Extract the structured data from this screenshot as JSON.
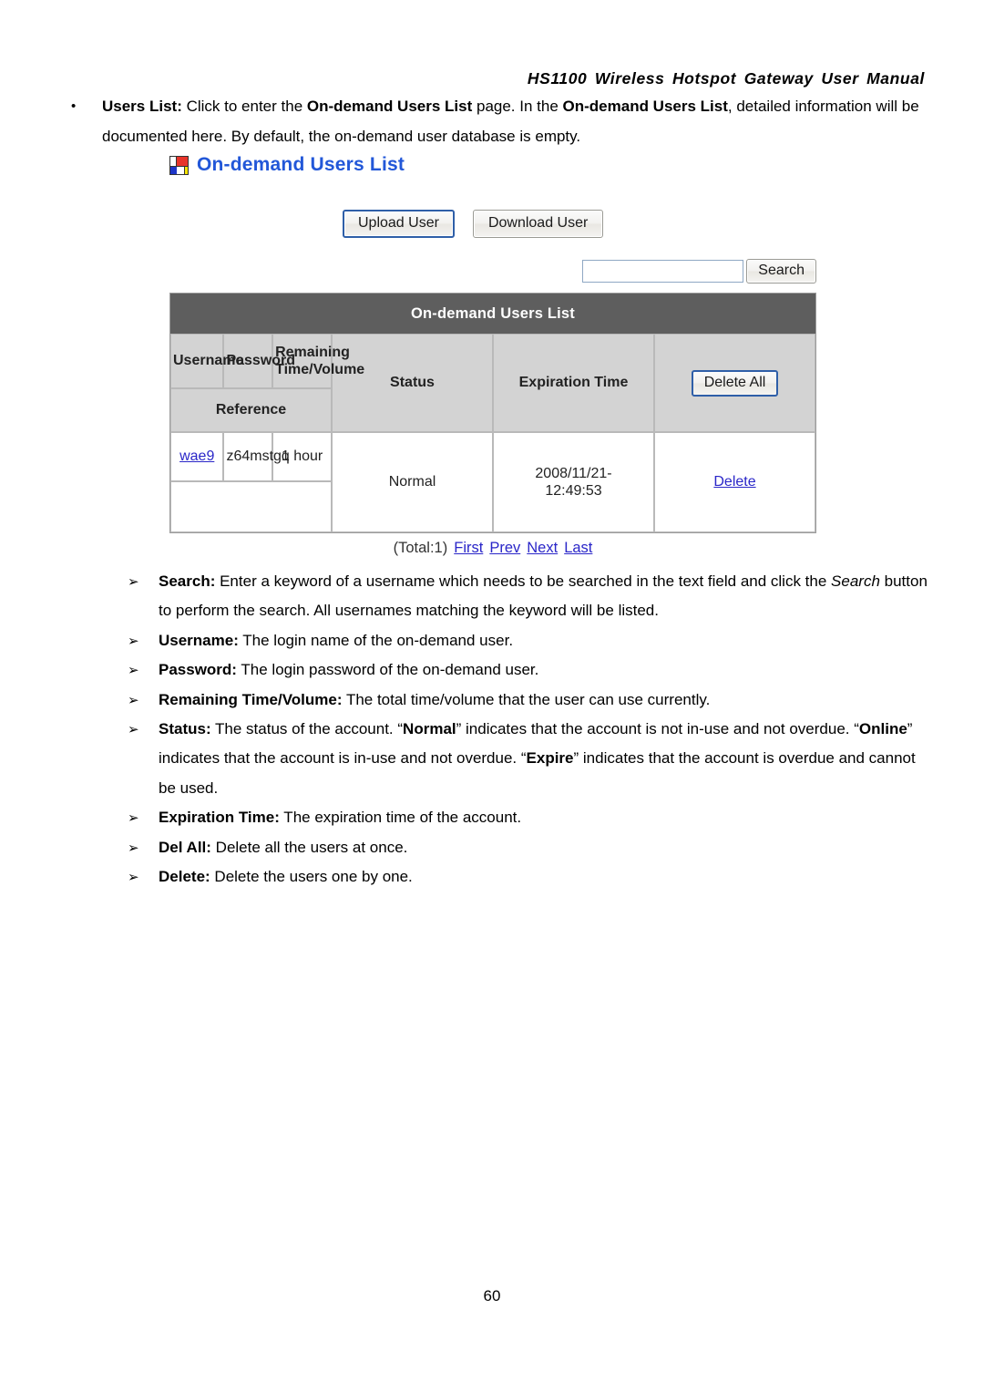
{
  "document": {
    "running_header": "HS1100 Wireless Hotspot Gateway User Manual",
    "page_number": "60"
  },
  "intro_bullet": {
    "marker": "•",
    "segments": [
      {
        "text": "Users List:",
        "style": "bold"
      },
      {
        "text": " Click to enter the ",
        "style": "normal"
      },
      {
        "text": "On-demand Users List",
        "style": "bold"
      },
      {
        "text": " page. In the ",
        "style": "normal"
      },
      {
        "text": "On-demand Users List",
        "style": "bold"
      },
      {
        "text": ", detailed information will be documented here. By default, the on-demand user database is empty.",
        "style": "normal"
      }
    ]
  },
  "screenshot": {
    "icon_name": "mondrian-squares-icon",
    "title": "On-demand Users List",
    "buttons": {
      "upload_user": "Upload User",
      "download_user": "Download User",
      "focused_button": "Upload User"
    },
    "search": {
      "value": "",
      "placeholder": "",
      "button_label": "Search"
    },
    "table": {
      "caption": "On-demand Users List",
      "headers": {
        "username": "Username",
        "password": "Password",
        "remaining_line1": "Remaining",
        "remaining_line2": "Time/Volume",
        "reference": "Reference",
        "status": "Status",
        "expiration_time": "Expiration Time",
        "delete_all": "Delete All"
      },
      "rows": [
        {
          "username": "wae9",
          "password": "z64mstgq",
          "remaining": "1 hour",
          "reference": "",
          "status": "Normal",
          "expiration_line1": "2008/11/21-",
          "expiration_line2": "12:49:53",
          "delete": "Delete"
        }
      ],
      "pager": {
        "total": "(Total:1)",
        "first": "First",
        "prev": "Prev",
        "next": "Next",
        "last": "Last"
      }
    },
    "colors": {
      "title_blue": "#2257d8",
      "caption_bar": "#5e5e5e",
      "header_gray": "#d3d3d3",
      "link_blue": "#2a26c8",
      "focus_border": "#2f5fa8"
    }
  },
  "definitions": [
    {
      "marker": "➢",
      "segments": [
        {
          "text": "Search:",
          "style": "bold"
        },
        {
          "text": " Enter a keyword of a username which needs to be searched in the text field and click the ",
          "style": "normal"
        },
        {
          "text": "Search",
          "style": "bold-italic"
        },
        {
          "text": " button to perform the search. All usernames matching the keyword will be listed.",
          "style": "normal"
        }
      ]
    },
    {
      "marker": "➢",
      "segments": [
        {
          "text": "Username:",
          "style": "bold"
        },
        {
          "text": " The login name of the on-demand user.",
          "style": "normal"
        }
      ]
    },
    {
      "marker": "➢",
      "segments": [
        {
          "text": "Password:",
          "style": "bold"
        },
        {
          "text": " The login password of the on-demand user.",
          "style": "normal"
        }
      ]
    },
    {
      "marker": "➢",
      "segments": [
        {
          "text": "Remaining Time/Volume:",
          "style": "bold"
        },
        {
          "text": " The total time/volume that the user can use currently.",
          "style": "normal"
        }
      ]
    },
    {
      "marker": "➢",
      "segments": [
        {
          "text": "Status:",
          "style": "bold"
        },
        {
          "text": " The status of the account. “",
          "style": "normal"
        },
        {
          "text": "Normal",
          "style": "bold"
        },
        {
          "text": "” indicates that the account is not in-use and not overdue. “",
          "style": "normal"
        },
        {
          "text": "Online",
          "style": "bold"
        },
        {
          "text": "” indicates that the account is in-use and not overdue. “",
          "style": "normal"
        },
        {
          "text": "Expire",
          "style": "bold"
        },
        {
          "text": "” indicates that the account is overdue and cannot be used.",
          "style": "normal"
        }
      ]
    },
    {
      "marker": "➢",
      "segments": [
        {
          "text": "Expiration Time:",
          "style": "bold"
        },
        {
          "text": " The expiration time of the account.",
          "style": "normal"
        }
      ]
    },
    {
      "marker": "➢",
      "segments": [
        {
          "text": "Del All:",
          "style": "bold"
        },
        {
          "text": " Delete all the users at once.",
          "style": "normal"
        }
      ]
    },
    {
      "marker": "➢",
      "segments": [
        {
          "text": "Delete:",
          "style": "bold"
        },
        {
          "text": " Delete the users one by one.",
          "style": "normal"
        }
      ]
    }
  ]
}
